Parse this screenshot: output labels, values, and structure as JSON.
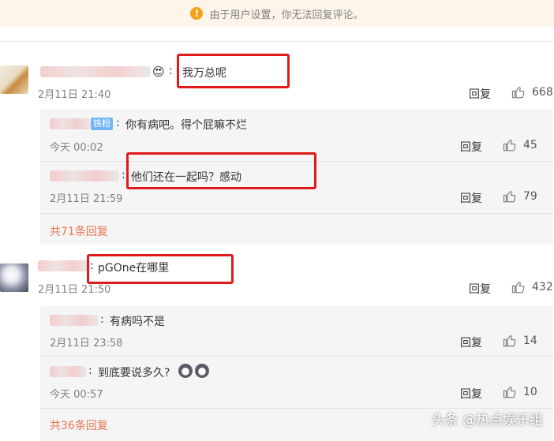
{
  "notice": {
    "text": "由于用户设置，你无法回复评论。"
  },
  "reply_label": "回复",
  "comments": [
    {
      "text": "我万总呢",
      "time": "2月11日 21:40",
      "likes": "668",
      "subs": [
        {
          "badge": "铁粉",
          "text": "你有病吧。得个屁嘛不烂",
          "time": "今天 00:02",
          "likes": "45"
        },
        {
          "text": "他们还在一起吗？感动",
          "time": "2月11日 21:59",
          "likes": "79"
        }
      ],
      "more": "共71条回复"
    },
    {
      "text": "pGOne在哪里",
      "time": "2月11日 21:50",
      "likes": "432",
      "subs": [
        {
          "text": "有病吗不是",
          "time": "2月11日 23:58",
          "likes": "14"
        },
        {
          "text": "到底要说多久?",
          "time": "今天 00:57",
          "likes": "10"
        }
      ],
      "more": "共36条回复"
    }
  ],
  "watermark": "头条 @热点娱乐组"
}
